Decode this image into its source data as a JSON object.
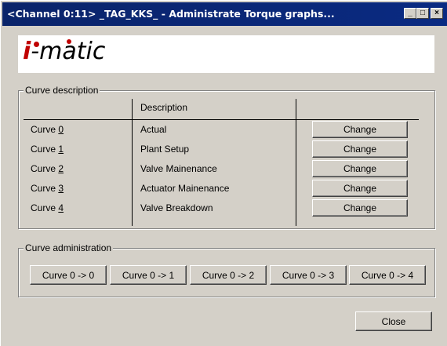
{
  "window": {
    "title": "<Channel 0:11> _TAG_KKS_ - Administrate Torque graphs...",
    "minimize_label": "_",
    "maximize_label": "□",
    "close_label": "×"
  },
  "logo": {
    "prefix": "i",
    "suffix": "-matic",
    "brand_color": "#c00000"
  },
  "curve_description": {
    "legend": "Curve description",
    "column_header": "Description",
    "rows": [
      {
        "label_prefix": "Curve ",
        "number": "0",
        "description": "Actual",
        "button": "Change"
      },
      {
        "label_prefix": "Curve ",
        "number": "1",
        "description": "Plant Setup",
        "button": "Change"
      },
      {
        "label_prefix": "Curve ",
        "number": "2",
        "description": "Valve Mainenance",
        "button": "Change"
      },
      {
        "label_prefix": "Curve ",
        "number": "3",
        "description": "Actuator Mainenance",
        "button": "Change"
      },
      {
        "label_prefix": "Curve ",
        "number": "4",
        "description": "Valve Breakdown",
        "button": "Change"
      }
    ]
  },
  "curve_administration": {
    "legend": "Curve administration",
    "buttons": [
      "Curve 0 -> 0",
      "Curve 0 -> 1",
      "Curve 0 -> 2",
      "Curve 0 -> 3",
      "Curve 0 -> 4"
    ]
  },
  "footer": {
    "close_label": "Close"
  },
  "colors": {
    "titlebar": "#0a246a",
    "face": "#d4d0c8"
  }
}
